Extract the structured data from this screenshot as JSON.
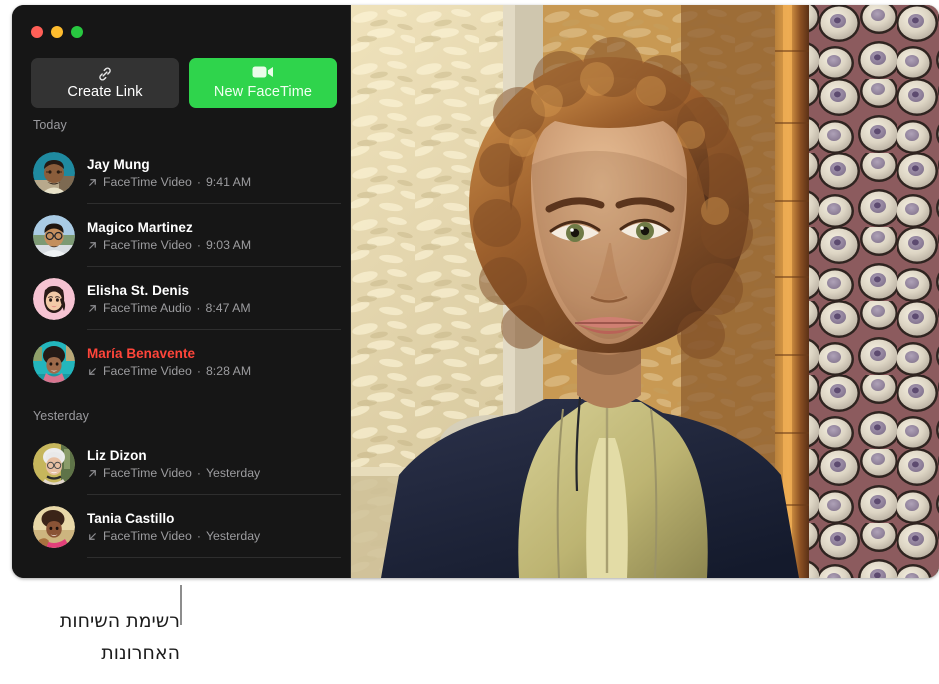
{
  "window": {
    "traffic_lights": [
      {
        "name": "close",
        "color": "#ff5f57"
      },
      {
        "name": "minimize",
        "color": "#febc2e"
      },
      {
        "name": "zoom",
        "color": "#28c840"
      }
    ]
  },
  "toolbar": {
    "create_link_label": "Create Link",
    "create_link_icon": "link-icon",
    "new_facetime_label": "New FaceTime",
    "new_facetime_icon": "video-camera-icon",
    "accent_green": "#2fd44c",
    "secondary_bg": "#333333"
  },
  "call_list": {
    "sections": [
      {
        "header": "Today",
        "calls": [
          {
            "name": "Jay Mung",
            "type": "FaceTime Video",
            "time": "9:41 AM",
            "separator": "·",
            "direction": "outgoing",
            "direction_icon": "arrow-up-right-icon",
            "missed": false,
            "avatar": "photo-jay-mung"
          },
          {
            "name": "Magico Martinez",
            "type": "FaceTime Video",
            "time": "9:03 AM",
            "separator": "·",
            "direction": "outgoing",
            "direction_icon": "arrow-up-right-icon",
            "missed": false,
            "avatar": "photo-magico-martinez"
          },
          {
            "name": "Elisha St. Denis",
            "type": "FaceTime Audio",
            "time": "8:47 AM",
            "separator": "·",
            "direction": "outgoing",
            "direction_icon": "arrow-up-right-icon",
            "missed": false,
            "avatar": "memoji-elisha-st-denis"
          },
          {
            "name": "María Benavente",
            "type": "FaceTime Video",
            "time": "8:28 AM",
            "separator": "·",
            "direction": "incoming",
            "direction_icon": "arrow-down-left-icon",
            "missed": true,
            "avatar": "photo-maria-benavente"
          }
        ]
      },
      {
        "header": "Yesterday",
        "calls": [
          {
            "name": "Liz Dizon",
            "type": "FaceTime Video",
            "time": "Yesterday",
            "separator": "·",
            "direction": "outgoing",
            "direction_icon": "arrow-up-right-icon",
            "missed": false,
            "avatar": "photo-liz-dizon"
          },
          {
            "name": "Tania Castillo",
            "type": "FaceTime Video",
            "time": "Yesterday",
            "separator": "·",
            "direction": "incoming",
            "direction_icon": "arrow-down-left-icon",
            "missed": false,
            "avatar": "photo-tania-castillo"
          }
        ]
      }
    ]
  },
  "photo_pane": {
    "description": "portrait-photo-of-person-with-curly-hair"
  },
  "callout": {
    "text_line_1": "רשימת השיחות",
    "text_line_2": "האחרונות"
  }
}
